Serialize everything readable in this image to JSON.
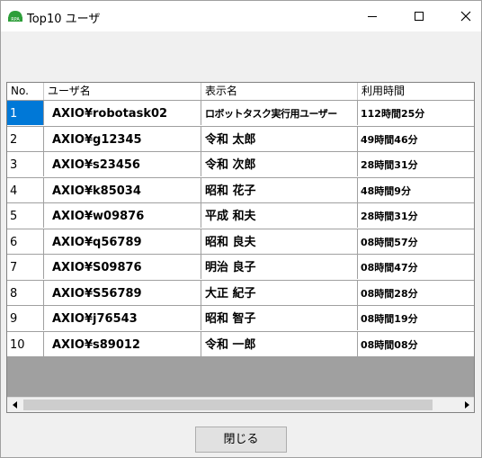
{
  "window": {
    "title": "Top10 ユーザ",
    "icon": "rpa-app-icon"
  },
  "table": {
    "columns": [
      "No.",
      "ユーザ名",
      "表示名",
      "利用時間"
    ],
    "rows": [
      {
        "no": "1",
        "user": "AXIO¥robotask02",
        "display": "ロボットタスク実行用ユーザー",
        "time": "112時間25分"
      },
      {
        "no": "2",
        "user": "AXIO¥g12345",
        "display": "令和 太郎",
        "time": "49時間46分"
      },
      {
        "no": "3",
        "user": "AXIO¥s23456",
        "display": "令和 次郎",
        "time": "28時間31分"
      },
      {
        "no": "4",
        "user": "AXIO¥k85034",
        "display": "昭和 花子",
        "time": "48時間9分"
      },
      {
        "no": "5",
        "user": "AXIO¥w09876",
        "display": "平成 和夫",
        "time": "28時間31分"
      },
      {
        "no": "6",
        "user": "AXIO¥q56789",
        "display": "昭和 良夫",
        "time": "08時間57分"
      },
      {
        "no": "7",
        "user": "AXIO¥S09876",
        "display": "明治 良子",
        "time": "08時間47分"
      },
      {
        "no": "8",
        "user": "AXIO¥S56789",
        "display": "大正 紀子",
        "time": "08時間28分"
      },
      {
        "no": "9",
        "user": "AXIO¥j76543",
        "display": "昭和 智子",
        "time": "08時間19分"
      },
      {
        "no": "10",
        "user": "AXIO¥s89012",
        "display": "令和 一郎",
        "time": "08時間08分"
      }
    ],
    "selected_row": 1
  },
  "buttons": {
    "close_label": "閉じる"
  },
  "colors": {
    "selection": "#0078d7",
    "empty_area": "#a0a0a0",
    "icon_green": "#2e9e3a"
  }
}
